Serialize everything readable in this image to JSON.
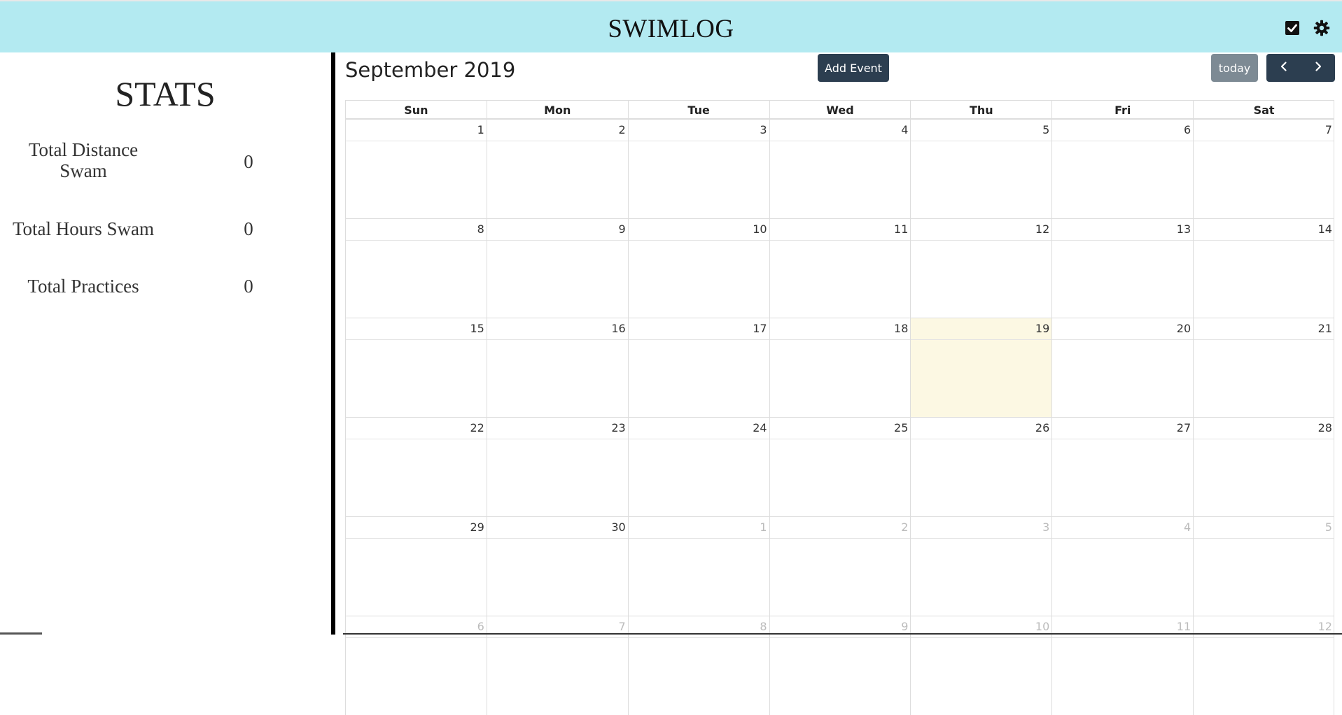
{
  "header": {
    "title": "SWIMLOG",
    "icons": [
      "checkbox-icon",
      "gear-icon"
    ]
  },
  "stats": {
    "title": "STATS",
    "items": [
      {
        "label": "Total Distance Swam",
        "value": "0"
      },
      {
        "label": "Total Hours Swam",
        "value": "0"
      },
      {
        "label": "Total Practices",
        "value": "0"
      }
    ]
  },
  "calendar": {
    "title": "September 2019",
    "add_event_label": "Add Event",
    "today_label": "today",
    "prev_icon": "chevron-left-icon",
    "next_icon": "chevron-right-icon",
    "weekdays": [
      "Sun",
      "Mon",
      "Tue",
      "Wed",
      "Thu",
      "Fri",
      "Sat"
    ],
    "weeks": [
      [
        "1",
        "2",
        "3",
        "4",
        "5",
        "6",
        "7"
      ],
      [
        "8",
        "9",
        "10",
        "11",
        "12",
        "13",
        "14"
      ],
      [
        "15",
        "16",
        "17",
        "18",
        "19",
        "20",
        "21"
      ],
      [
        "22",
        "23",
        "24",
        "25",
        "26",
        "27",
        "28"
      ],
      [
        "29",
        "30",
        "1",
        "2",
        "3",
        "4",
        "5"
      ],
      [
        "6",
        "7",
        "8",
        "9",
        "10",
        "11",
        "12"
      ]
    ],
    "today_date": "19",
    "colors": {
      "header_bg": "#b3eaf1",
      "button_dark": "#2c3e50",
      "button_gray": "#7d8a94",
      "today_bg": "#fcf8e3"
    }
  }
}
